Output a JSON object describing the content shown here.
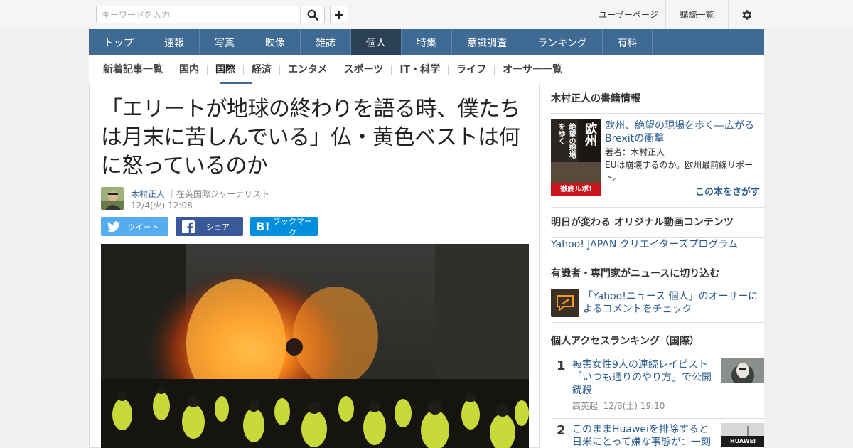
{
  "topbar": {
    "search_placeholder": "キーワードを入力",
    "user_page": "ユーザーページ",
    "subscriptions": "購読一覧"
  },
  "main_nav": [
    "トップ",
    "速報",
    "写真",
    "映像",
    "雑誌",
    "個人",
    "特集",
    "意識調査",
    "ランキング",
    "有料"
  ],
  "main_nav_active": "個人",
  "sub_nav": [
    "新着記事一覧",
    "国内",
    "国際",
    "経済",
    "エンタメ",
    "スポーツ",
    "IT・科学",
    "ライフ",
    "オーサー一覧"
  ],
  "sub_nav_active": "国際",
  "article": {
    "headline": "「エリートが地球の終わりを語る時、僕たちは月末に苦しんでいる」仏・黄色ベストは何に怒っているのか",
    "author": "木村正人",
    "author_title": "｜在英国際ジャーナリスト",
    "date": "12/4(火) 12:08",
    "share_twitter": "ツイート",
    "share_facebook": "シェア",
    "share_hatena": "ブックマーク"
  },
  "sidebar": {
    "books_heading": "木村正人の書籍情報",
    "book_title": "欧州、絶望の現場を歩く―広がるBrexitの衝撃",
    "book_cover_title": "欧州",
    "book_cover_sub": "絶望の現場を歩く",
    "book_cover_badge": "徹底ルポ!",
    "book_author": "著者：木村正人",
    "book_desc": "EUは崩壊するのか。欧州最前線リポート。",
    "book_find": "この本をさがす",
    "video_heading": "明日が変わる オリジナル動画コンテンツ",
    "video_link": "Yahoo! JAPAN クリエイターズプログラム",
    "expert_heading": "有識者・専門家がニュースに切り込む",
    "expert_link": "「Yahoo!ニュース 個人」のオーサーによるコメントをチェック",
    "ranking_heading": "個人アクセスランキング（国際）",
    "ranking": [
      {
        "rank": "1",
        "title": "被害女性9人の連続レイピスト「いつも通りのやり方」で公開銃殺",
        "author": "高英起",
        "date": "12/8(土) 19:10"
      },
      {
        "rank": "2",
        "title": "このままHuaweiを排除すると日米にとって嫌な事態が：一刻",
        "thumb_text": "HUAWEI"
      }
    ]
  },
  "colors": {
    "nav_bg": "#3e6a94",
    "nav_active": "#2b3f55",
    "link": "#2a5b8d",
    "twitter": "#55acee",
    "facebook": "#3b5998",
    "hatena": "#008fde"
  }
}
